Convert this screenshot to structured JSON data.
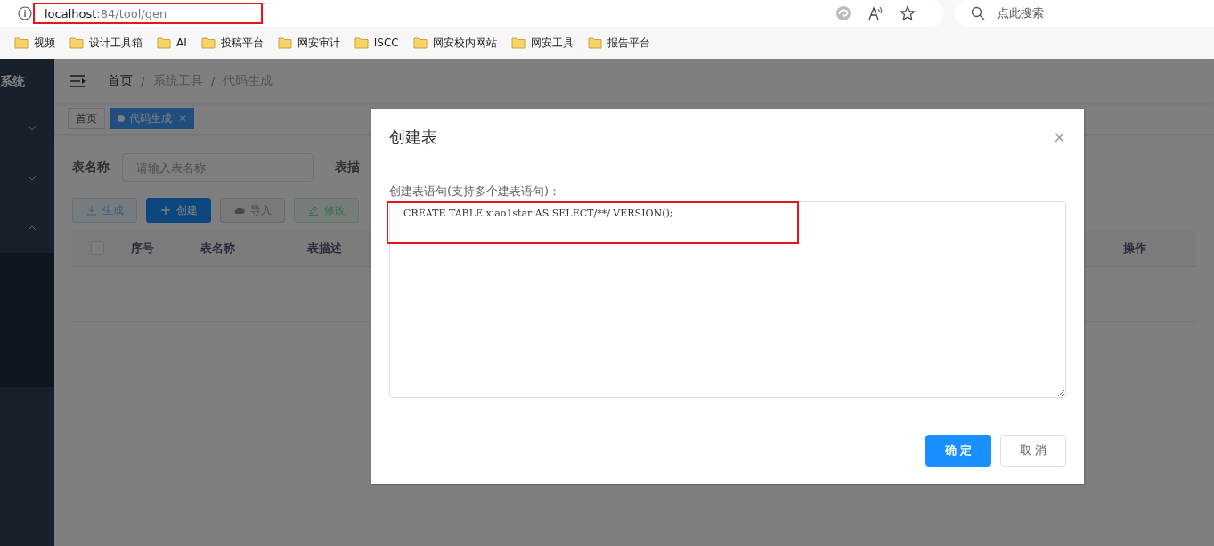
{
  "browser": {
    "url": {
      "host": "localhost",
      "path": ":84/tool/gen"
    },
    "search": {
      "placeholder": "点此搜索"
    },
    "bookmarks": [
      {
        "label": "视频"
      },
      {
        "label": "设计工具箱"
      },
      {
        "label": "AI"
      },
      {
        "label": "投稿平台"
      },
      {
        "label": "网安审计"
      },
      {
        "label": "ISCC"
      },
      {
        "label": "网安校内网站"
      },
      {
        "label": "网安工具"
      },
      {
        "label": "报告平台"
      }
    ]
  },
  "sidebar": {
    "title": "系统",
    "menus": [
      {
        "expanded": false
      },
      {
        "expanded": false
      },
      {
        "expanded": true
      }
    ]
  },
  "breadcrumb": {
    "separator": "/",
    "items": [
      {
        "label": "首页"
      },
      {
        "label": "系统工具"
      },
      {
        "label": "代码生成"
      }
    ]
  },
  "tags": [
    {
      "label": "首页",
      "selected": false
    },
    {
      "label": "代码生成",
      "selected": true,
      "close": "×"
    }
  ],
  "search_form": {
    "fields": [
      {
        "label": "表名称",
        "placeholder": "请输入表名称"
      },
      {
        "label": "表描"
      }
    ]
  },
  "toolbar": [
    {
      "kind": "primary",
      "label": "生成",
      "disabled": true
    },
    {
      "kind": "primary",
      "label": "创建",
      "disabled": false
    },
    {
      "kind": "info",
      "label": "导入",
      "disabled": false
    },
    {
      "kind": "success",
      "label": "修改",
      "disabled": true
    }
  ],
  "table": {
    "select_all_checked": false,
    "columns": [
      "序号",
      "表名称",
      "表描述",
      "操作"
    ]
  },
  "dialog": {
    "title": "创建表",
    "field_label": "创建表语句(支持多个建表语句)：",
    "value": "CREATE TABLE xiao1star AS SELECT/**/ VERSION();",
    "buttons": [
      {
        "kind": "primary",
        "label": "确 定"
      },
      {
        "kind": "default",
        "label": "取 消"
      }
    ]
  }
}
